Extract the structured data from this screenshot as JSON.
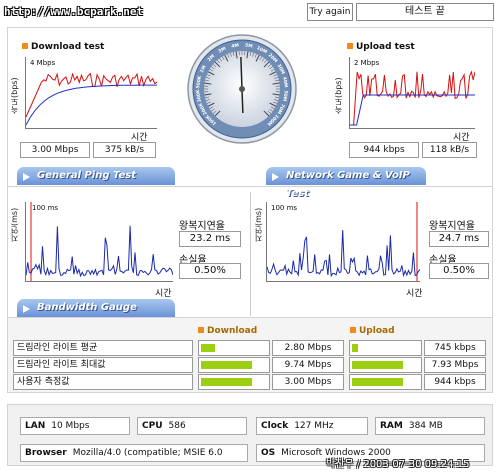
{
  "url": "http://www.bcpark.net",
  "try_again": "Try again",
  "test_status": "테스트 끝",
  "download": {
    "title": "Download test",
    "scale": "4 Mbps",
    "ylabel": "속도(bps)",
    "xlabel": "시간",
    "mbps": "3.00 Mbps",
    "kbs": "375 kB/s"
  },
  "upload": {
    "title": "Upload test",
    "scale": "2 Mbps",
    "ylabel": "속도(bps)",
    "xlabel": "시간",
    "kbps": "944 kbps",
    "kbs": "118 kB/s"
  },
  "gauge": {
    "ticks": [
      "100K",
      "200K",
      "300K",
      "500K",
      "1M",
      "2M",
      "3M",
      "4M",
      "5M",
      "10M",
      "20M",
      "30M",
      "40M",
      "50M",
      "70M",
      "100M"
    ],
    "needle_value_mbps": 3.0
  },
  "ping_tab": "General Ping Test",
  "game_tab": "Network Game & VoIP Test",
  "ping": {
    "scale": "100 ms",
    "ylabel": "지연(ms)",
    "xlabel": "시간",
    "delay_label": "왕복지연율",
    "delay": "23.2 ms",
    "loss_label": "손실율",
    "loss": "0.50%"
  },
  "game": {
    "scale": "100 ms",
    "ylabel": "지연(ms)",
    "xlabel": "시간",
    "delay_label": "왕복지연율",
    "delay": "24.7 ms",
    "loss_label": "손실율",
    "loss": "0.50%"
  },
  "bandwidth_tab": "Bandwidth Gauge",
  "bandwidth": {
    "download_header": "Download",
    "upload_header": "Upload",
    "rows": [
      {
        "label": "드림라인 라이트 평균",
        "down": "2.80 Mbps",
        "down_fill": 0.22,
        "up": "745 kbps",
        "up_fill": 0.1
      },
      {
        "label": "드림라인 라이트 최대값",
        "down": "9.74 Mbps",
        "down_fill": 0.8,
        "up": "7.93 Mbps",
        "up_fill": 0.8
      },
      {
        "label": "사용자 측정값",
        "down": "3.00 Mbps",
        "down_fill": 0.8,
        "up": "944 kbps",
        "up_fill": 0.8
      }
    ]
  },
  "system": {
    "lan_label": "LAN",
    "lan": "10 Mbps",
    "cpu_label": "CPU",
    "cpu": "586",
    "clock_label": "Clock",
    "clock": "127 MHz",
    "ram_label": "RAM",
    "ram": "384 MB",
    "browser_label": "Browser",
    "browser": "Mozilla/4.0 (compatible; MSIE 6.0",
    "os_label": "OS",
    "os": "Microsoft Windows 2000"
  },
  "footer": "박찬우 / 2003-07-30 09:24:15",
  "colors": {
    "download_line": "#d81010",
    "fit_line": "#2030c0",
    "ping_line": "#1a2aa8",
    "bar_fill": "#9ccf12",
    "tab": "#6a92d6",
    "accent": "#f08a1c"
  }
}
